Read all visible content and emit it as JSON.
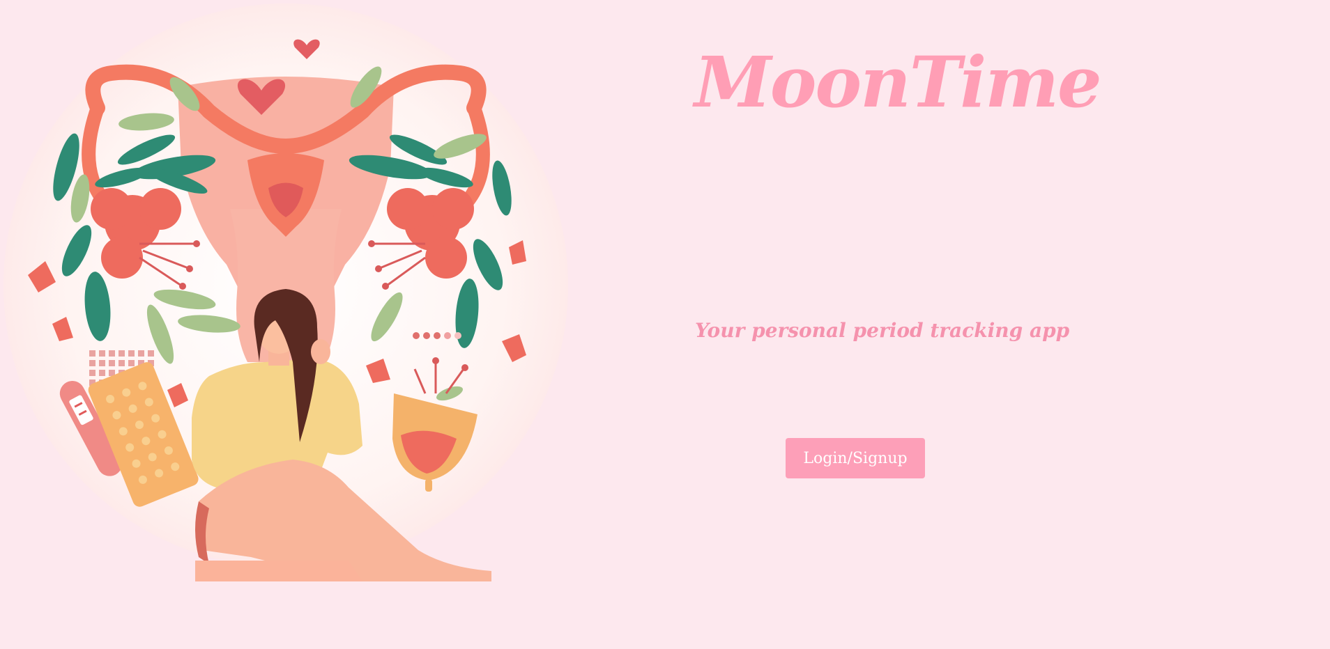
{
  "app": {
    "title": "MoonTime",
    "tagline": "Your personal period tracking app"
  },
  "actions": {
    "login_label": "Login/Signup"
  },
  "illustration": {
    "icon": "woman-uterus-illustration"
  },
  "colors": {
    "background": "#fde8ee",
    "brand": "#ff9eb5",
    "button": "#fd9fb8",
    "button_text": "#ffffff"
  }
}
